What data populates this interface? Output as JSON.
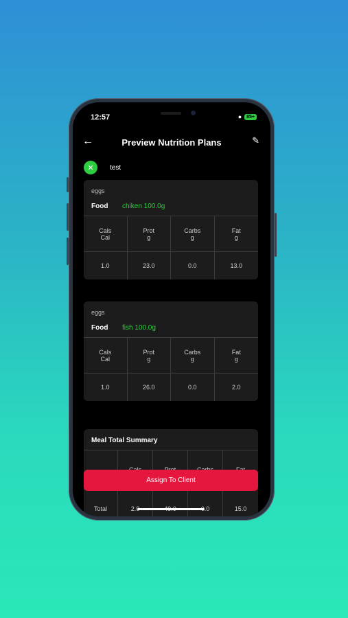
{
  "status": {
    "time": "12:57",
    "battery": "85+"
  },
  "header": {
    "title": "Preview Nutrition Plans"
  },
  "client": {
    "name": "test"
  },
  "nutrient_headers": [
    {
      "name": "Cals",
      "unit": "Cal"
    },
    {
      "name": "Prot",
      "unit": "g"
    },
    {
      "name": "Carbs",
      "unit": "g"
    },
    {
      "name": "Fat",
      "unit": "g"
    }
  ],
  "meals": [
    {
      "label": "eggs",
      "food_key": "Food",
      "food_value": "chiken 100.0g",
      "values": [
        "1.0",
        "23.0",
        "0.0",
        "13.0"
      ]
    },
    {
      "label": "eggs",
      "food_key": "Food",
      "food_value": "fish 100.0g",
      "values": [
        "1.0",
        "26.0",
        "0.0",
        "2.0"
      ]
    }
  ],
  "summary": {
    "title": "Meal Total Summary",
    "headers": [
      "Cals",
      "Prot",
      "Carbs",
      "Fat"
    ],
    "row_label": "Total",
    "values": [
      "2.0",
      "49.0",
      "0.0",
      "15.0"
    ]
  },
  "assign_button": "Assign To Client"
}
